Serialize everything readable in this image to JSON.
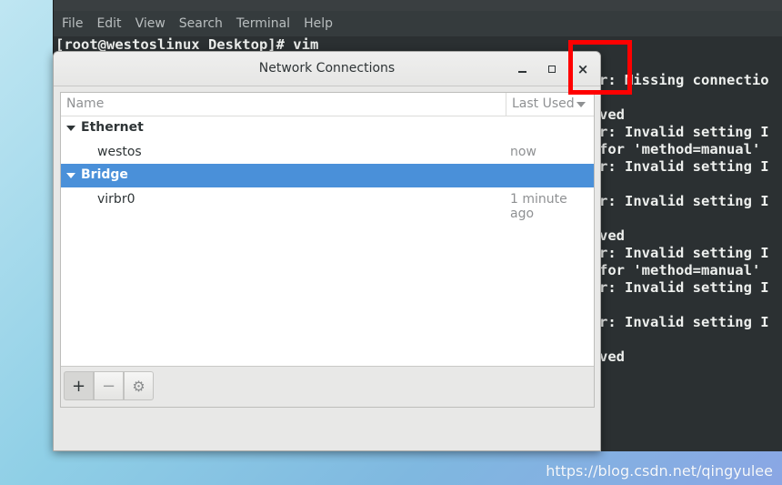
{
  "terminal": {
    "menu": [
      "File",
      "Edit",
      "View",
      "Search",
      "Terminal",
      "Help"
    ],
    "prompt": "[root@westoslinux Desktop]# vim",
    "right_lines": [
      "r: Missing connectio",
      "",
      "ved",
      "r: Invalid setting I",
      "for 'method=manual'",
      "r: Invalid setting I",
      "",
      "r: Invalid setting I",
      "",
      "ved",
      "r: Invalid setting I",
      "for 'method=manual'",
      "r: Invalid setting I",
      "",
      "r: Invalid setting I",
      "",
      "ved"
    ]
  },
  "dialog": {
    "title": "Network Connections",
    "buttons": {
      "minimize": "minimize-icon",
      "maximize": "maximize-icon",
      "close": "×"
    },
    "columns": {
      "name": "Name",
      "last_used": "Last Used"
    },
    "groups": [
      {
        "label": "Ethernet",
        "selected": false,
        "connections": [
          {
            "name": "westos",
            "last_used": "now"
          }
        ]
      },
      {
        "label": "Bridge",
        "selected": true,
        "connections": [
          {
            "name": "virbr0",
            "last_used": "1 minute ago"
          }
        ]
      }
    ],
    "toolbar": {
      "add": "+",
      "remove": "−",
      "settings": "⚙"
    }
  },
  "watermark": "https://blog.csdn.net/qingyulee",
  "colors": {
    "selection": "#4a90d9",
    "highlight_box": "#ff0000",
    "terminal_bg": "#2b3032"
  }
}
